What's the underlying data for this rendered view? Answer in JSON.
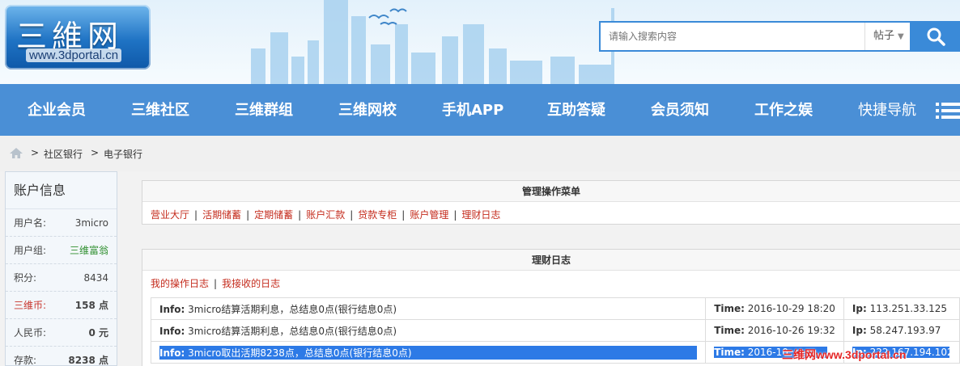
{
  "header": {
    "logo_text": "三維网",
    "logo_url": "www.3dportal.cn",
    "search": {
      "placeholder": "请输入搜索内容",
      "scope": "帖子"
    }
  },
  "colors": {
    "accent": "#4a8fd6",
    "link_red": "#c42b1c",
    "selection": "#2d7ae6"
  },
  "nav": {
    "items": [
      "企业会员",
      "三维社区",
      "三维群组",
      "三维网校",
      "手机APP",
      "互助答疑",
      "会员须知",
      "工作之娱",
      "快捷导航"
    ]
  },
  "breadcrumb": [
    "社区银行",
    "电子银行"
  ],
  "sidebar": {
    "title": "账户信息",
    "rows": [
      {
        "label": "用户名:",
        "value": "3micro"
      },
      {
        "label": "用户组:",
        "value": "三维富翁"
      },
      {
        "label": "积分:",
        "value": "8434"
      },
      {
        "label": "三维币:",
        "value": "158 点"
      },
      {
        "label": "人民币:",
        "value": "0 元"
      },
      {
        "label": "存款:",
        "value": "8238 点"
      }
    ]
  },
  "manage": {
    "title": "管理操作菜单",
    "links": [
      "营业大厅",
      "活期储蓄",
      "定期储蓄",
      "账户汇款",
      "贷款专柜",
      "账户管理",
      "理财日志"
    ]
  },
  "log": {
    "title": "理财日志",
    "tabs": [
      "我的操作日志",
      "我接收的日志"
    ],
    "rows": [
      {
        "info": "3micro结算活期利息，总结息0点(银行结息0点)",
        "time": "2016-10-29 18:20",
        "ip": "113.251.33.125"
      },
      {
        "info": "3micro结算活期利息，总结息0点(银行结息0点)",
        "time": "2016-10-26 19:32",
        "ip": "58.247.193.97"
      },
      {
        "info": "3micro取出活期8238点，总结息0点(银行结息0点)",
        "time": "2016-10",
        "ip": "222.167.194.102"
      }
    ],
    "labels": {
      "info": "Info:",
      "time": "Time:",
      "ip": "Ip:"
    }
  },
  "watermark": "三维网www.3dportal.cn"
}
